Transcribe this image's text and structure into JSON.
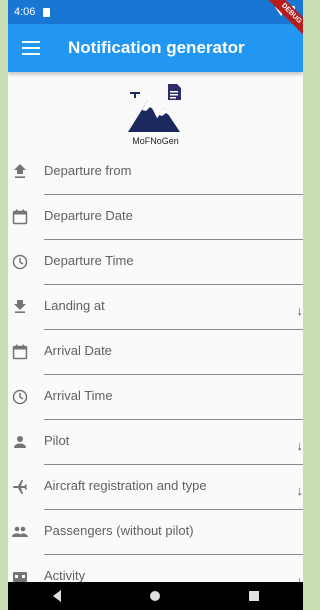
{
  "status_bar": {
    "time": "4:06",
    "debug_label": "DEBUG"
  },
  "app_bar": {
    "title": "Notification generator",
    "menu_icon": "hamburger-menu-icon"
  },
  "logo": {
    "name": "MoFNoGen",
    "colors": {
      "dark": "#1a2a5e",
      "accent": "#2b2b6e"
    }
  },
  "form": {
    "fields": [
      {
        "icon": "upload-icon",
        "label": "Departure from",
        "dropdown": false
      },
      {
        "icon": "calendar-icon",
        "label": "Departure Date",
        "dropdown": false
      },
      {
        "icon": "clock-icon",
        "label": "Departure Time",
        "dropdown": false
      },
      {
        "icon": "download-icon",
        "label": "Landing at",
        "dropdown": true
      },
      {
        "icon": "calendar-icon",
        "label": "Arrival Date",
        "dropdown": false
      },
      {
        "icon": "clock-icon",
        "label": "Arrival Time",
        "dropdown": false
      },
      {
        "icon": "person-icon",
        "label": "Pilot",
        "dropdown": true
      },
      {
        "icon": "airplane-icon",
        "label": "Aircraft registration and type",
        "dropdown": true
      },
      {
        "icon": "people-icon",
        "label": "Passengers (without pilot)",
        "dropdown": false
      },
      {
        "icon": "activity-icon",
        "label": "Activity",
        "dropdown": true
      }
    ],
    "dropdown_glyph": "↓"
  },
  "colors": {
    "primary": "#2196f3",
    "status_bar": "#1976d2",
    "background": "#fafafa"
  }
}
